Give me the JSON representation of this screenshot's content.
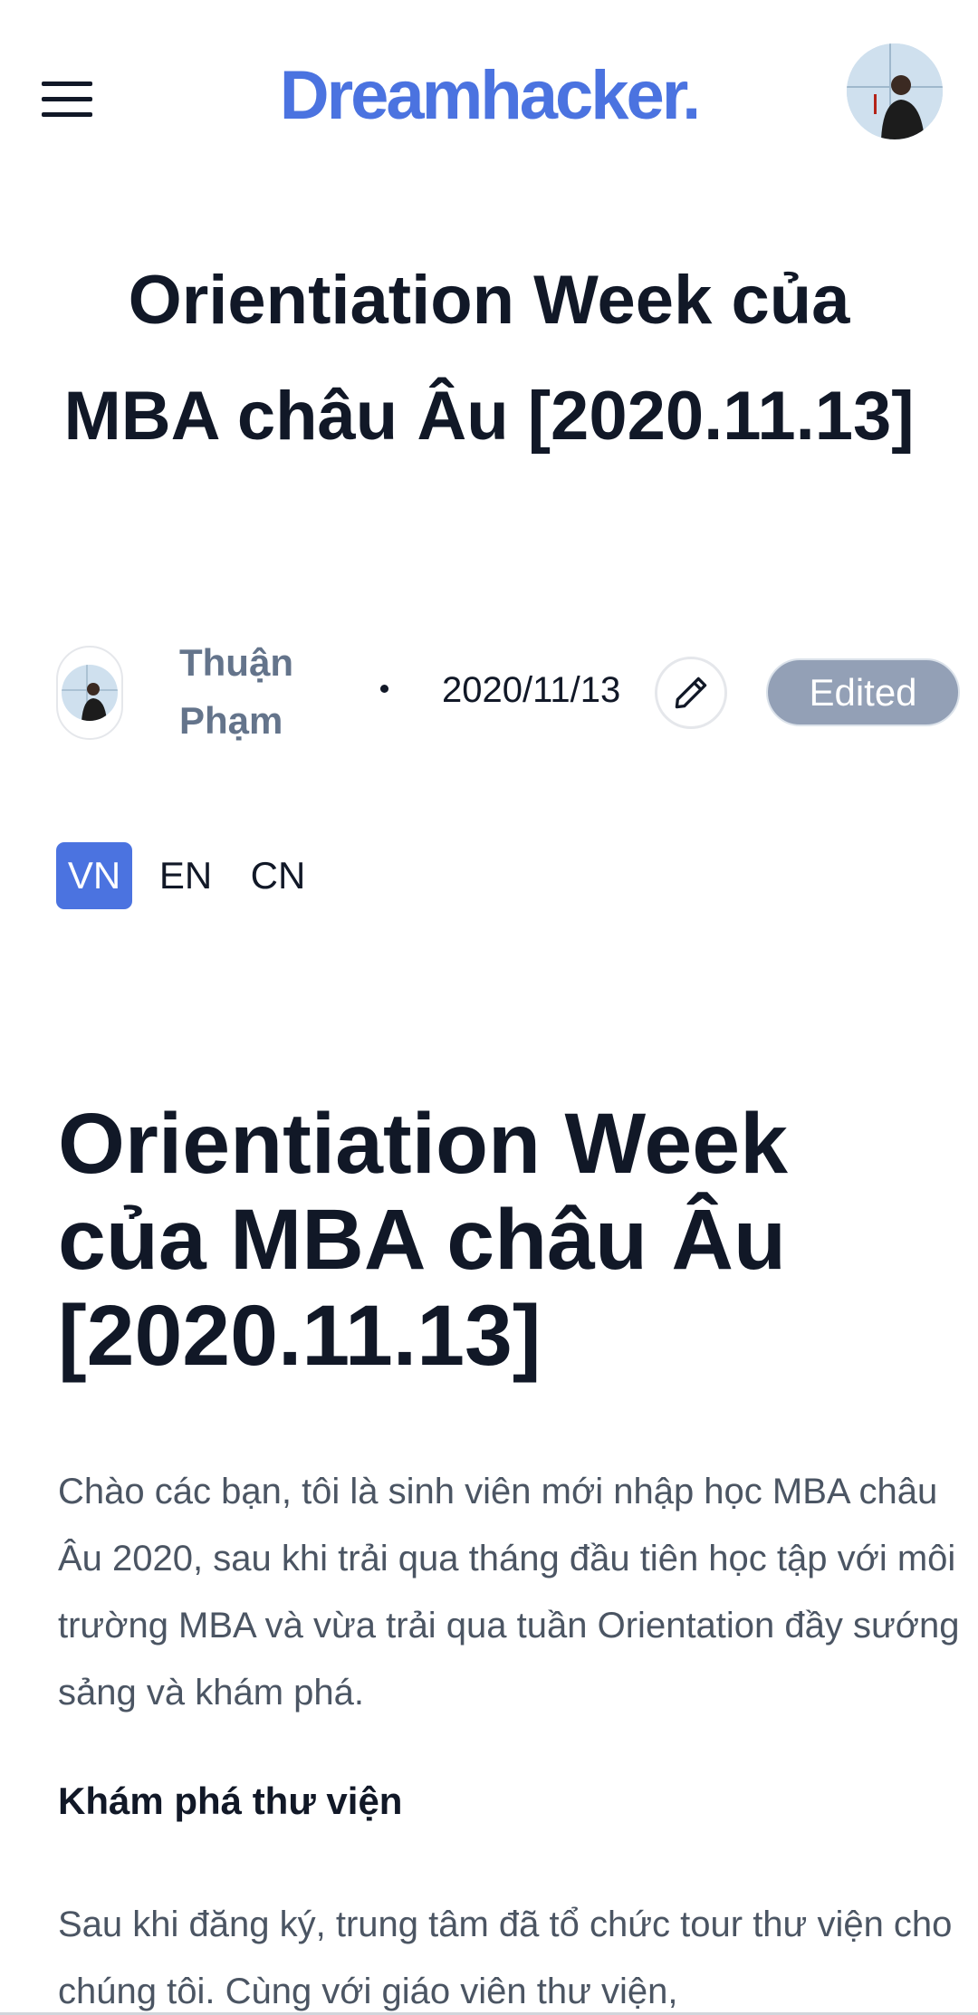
{
  "header": {
    "menu_icon": "hamburger-menu-icon",
    "logo": "Dreamhacker.",
    "avatar": "user-avatar"
  },
  "post": {
    "title": "Orientiation Week của MBA châu Âu [2020.11.13]",
    "author": "Thuận Phạm",
    "date": "2020/11/13",
    "edit_icon": "pencil-icon",
    "status_badge": "Edited",
    "languages": [
      "VN",
      "EN",
      "CN"
    ],
    "active_language": "VN"
  },
  "article": {
    "title": "Orientiation Week của MBA châu Âu [2020.11.13]",
    "intro": "Chào các bạn, tôi là sinh viên mới nhập học MBA châu Âu 2020, sau khi trải qua tháng đầu tiên học tập với môi trường MBA và vừa trải qua tuần Orientation đầy sướng sảng và khám phá.",
    "section_heading": "Khám phá thư viện",
    "section_text": "Sau khi đăng ký, trung tâm đã tổ chức tour thư viện cho chúng tôi. Cùng với giáo viên thư viện,"
  },
  "colors": {
    "brand": "#4b73e0",
    "title_text": "#111827",
    "body_text": "#4b5563",
    "author_text": "#64748b",
    "badge_bg": "#93a0b6"
  }
}
